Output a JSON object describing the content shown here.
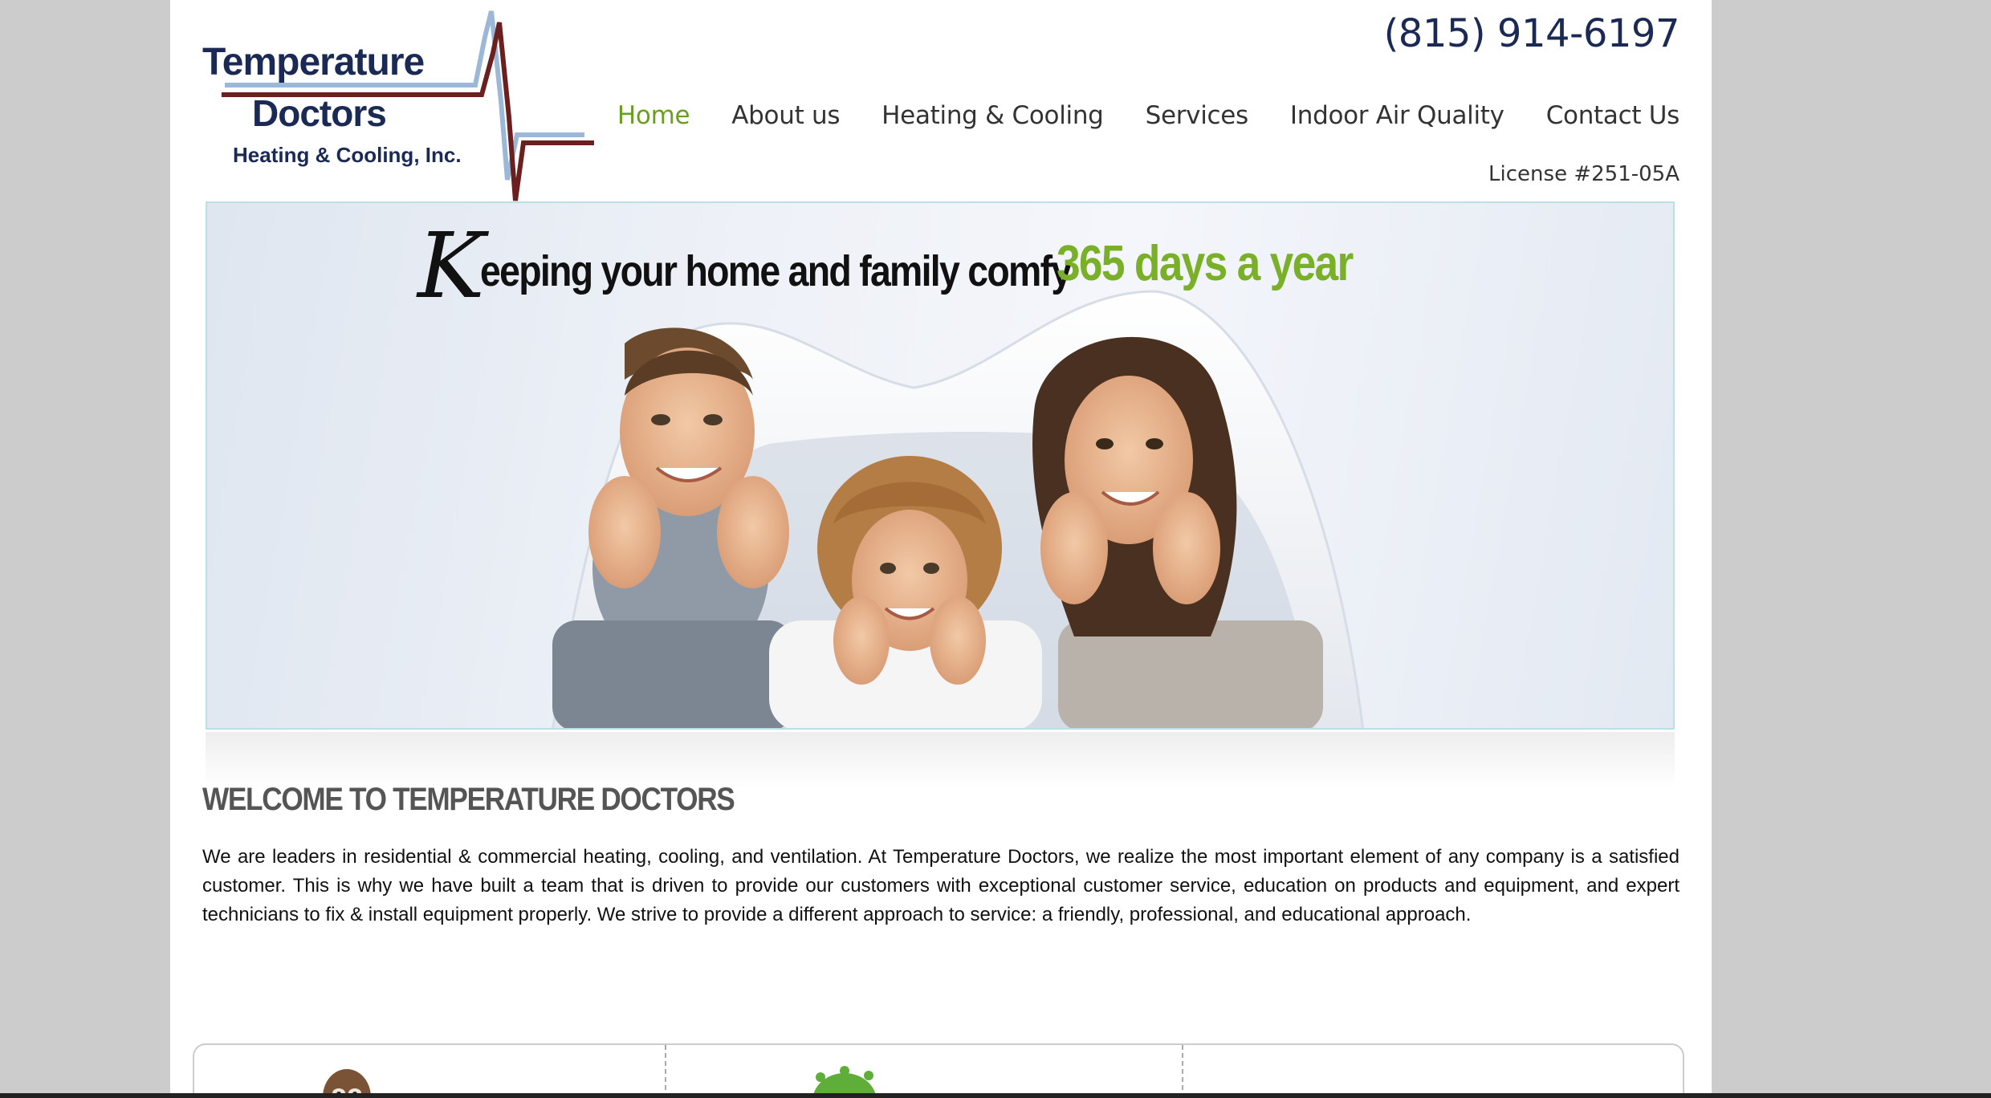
{
  "header": {
    "logo": {
      "line1": "Temperature",
      "line2": "Doctors",
      "line3": "Heating & Cooling, Inc."
    },
    "phone": "(815) 914-6197",
    "license": "License #251-05A"
  },
  "nav": {
    "items": [
      {
        "label": "Home",
        "active": true
      },
      {
        "label": "About us",
        "active": false
      },
      {
        "label": "Heating & Cooling",
        "active": false
      },
      {
        "label": "Services",
        "active": false
      },
      {
        "label": "Indoor Air Quality",
        "active": false
      },
      {
        "label": "Contact Us",
        "active": false
      }
    ]
  },
  "hero": {
    "tagline_k": "K",
    "tagline_main": "eeping your home and family comfy",
    "tagline_green": "365 days a year"
  },
  "welcome": {
    "title": "WELCOME TO TEMPERATURE DOCTORS",
    "body": "We are leaders in residential & commercial heating, cooling, and ventilation. At Temperature Doctors, we realize the most important element of any company is a satisfied customer. This is why we have built a team that is driven to provide our customers with exceptional customer service, education on products and equipment, and expert technicians to fix & install equipment properly. We strive to provide a different approach to service: a friendly, professional, and educational approach."
  },
  "colors": {
    "accent_green": "#6a9e1f",
    "navy": "#1b2a55",
    "ekg_red": "#6b1f1f",
    "ekg_blue": "#9bb8d8"
  }
}
